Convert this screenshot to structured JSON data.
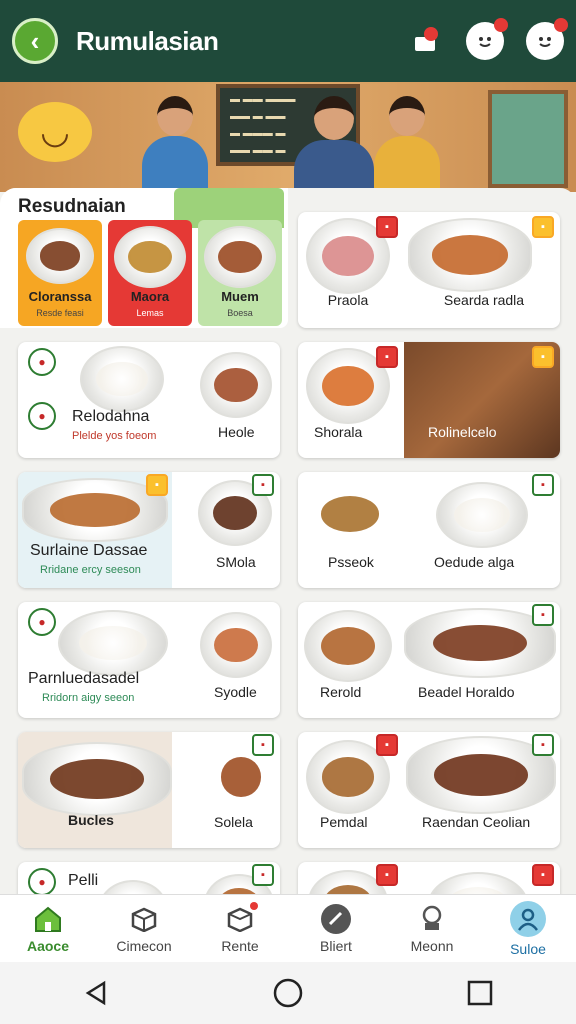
{
  "header": {
    "title": "Rumulasian",
    "back_icon": "back-arrow-icon",
    "actions": [
      "bag-icon",
      "face-icon",
      "face-icon"
    ]
  },
  "category": {
    "title": "Resudnaian",
    "tiles": [
      {
        "name": "Cloranssa",
        "sub": "Resde feasi",
        "color": "#f6a623"
      },
      {
        "name": "Maora",
        "sub": "Lemas",
        "color": "#e53935"
      },
      {
        "name": "Muem",
        "sub": "Boesa",
        "color": "#bfe3a8"
      }
    ]
  },
  "featured": {
    "name": "Praola",
    "name2": "Searda radla"
  },
  "cards": [
    {
      "name": "Relodahna",
      "sub": "Plelde yos foeom"
    },
    {
      "name": "Heole"
    },
    {
      "name": "Shorala"
    },
    {
      "name": "Rolinelcelo"
    },
    {
      "name": "Surlaine Dassae",
      "sub": "Rridane ercy seeson"
    },
    {
      "name": "SMola"
    },
    {
      "name": "Psseok"
    },
    {
      "name": "Oedude alga"
    },
    {
      "name": "Parnluedasadel",
      "sub": "Rridorn aigy seeon"
    },
    {
      "name": "Syodle"
    },
    {
      "name": "Rerold"
    },
    {
      "name": "Beadel Horaldo"
    },
    {
      "name": "Bucles"
    },
    {
      "name": "Solela"
    },
    {
      "name": "Pemdal"
    },
    {
      "name": "Raendan Ceolian"
    },
    {
      "name": "Pelli"
    }
  ],
  "bottom_nav": [
    {
      "label": "Aaoce",
      "icon": "home-icon"
    },
    {
      "label": "Cimecon",
      "icon": "box-icon"
    },
    {
      "label": "Rente",
      "icon": "package-icon"
    },
    {
      "label": "Bliert",
      "icon": "tag-icon"
    },
    {
      "label": "Meonn",
      "icon": "chef-icon"
    },
    {
      "label": "Suloe",
      "icon": "user-icon"
    }
  ],
  "colors": {
    "header": "#1f4a3a",
    "accent_green": "#3a8c2e",
    "accent_red": "#e53935"
  }
}
